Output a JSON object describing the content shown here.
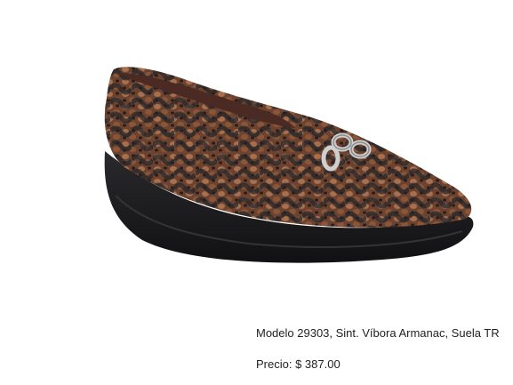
{
  "product": {
    "image_alt": "product-photo-snakeskin-wedge-loafer",
    "description": "Modelo 29303, Sint. Víbora Armanac, Suela TR",
    "price_label": "Precio:",
    "price_value": "$ 387.00"
  },
  "colors": {
    "background": "#ffffff",
    "text": "#222222",
    "sole": "#1b1b1d",
    "upper_base": "#5c3a2b",
    "upper_light": "#a56b4a",
    "ornament": "#c9c9c9"
  }
}
